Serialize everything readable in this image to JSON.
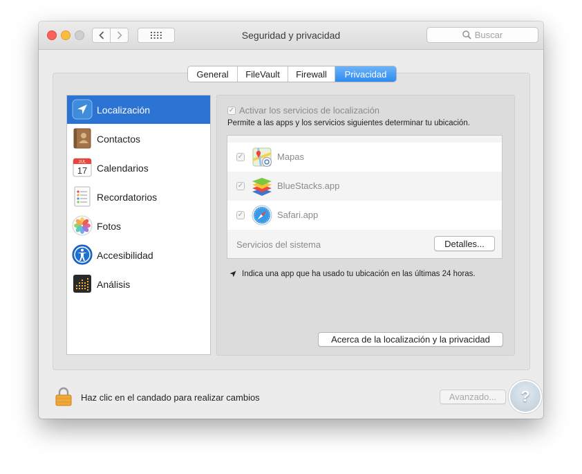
{
  "window": {
    "title": "Seguridad y privacidad"
  },
  "toolbar": {
    "search_placeholder": "Buscar"
  },
  "tabs": [
    {
      "label": "General"
    },
    {
      "label": "FileVault"
    },
    {
      "label": "Firewall"
    },
    {
      "label": "Privacidad"
    }
  ],
  "active_tab": "Privacidad",
  "sidebar": {
    "items": [
      {
        "label": "Localización",
        "icon": "location-arrow-icon",
        "selected": true
      },
      {
        "label": "Contactos",
        "icon": "contacts-book-icon"
      },
      {
        "label": "Calendarios",
        "icon": "calendar-icon",
        "icon_month": "JUL",
        "icon_day": "17"
      },
      {
        "label": "Recordatorios",
        "icon": "reminders-icon"
      },
      {
        "label": "Fotos",
        "icon": "photos-icon"
      },
      {
        "label": "Accesibilidad",
        "icon": "accessibility-icon"
      },
      {
        "label": "Análisis",
        "icon": "analysis-icon"
      }
    ]
  },
  "panel": {
    "enable_label": "Activar los servicios de localización",
    "enable_checked": true,
    "description": "Permite a las apps y los servicios siguientes determinar tu ubicación.",
    "apps": [
      {
        "name": "Mapas",
        "checked": true,
        "icon": "maps-icon"
      },
      {
        "name": "BlueStacks.app",
        "checked": true,
        "icon": "bluestacks-icon"
      },
      {
        "name": "Safari.app",
        "checked": true,
        "icon": "safari-compass-icon"
      }
    ],
    "system_services_label": "Servicios del sistema",
    "details_button": "Detalles...",
    "note": "Indica una app que ha usado tu ubicación en las últimas 24 horas.",
    "about_button": "Acerca de la localización y la privacidad"
  },
  "footer": {
    "lock_text": "Haz clic en el candado para realizar cambios",
    "advanced_button": "Avanzado..."
  },
  "colors": {
    "selection": "#2b74d4",
    "tab_active": "#2d8cf0",
    "window_bg": "#ececec"
  }
}
